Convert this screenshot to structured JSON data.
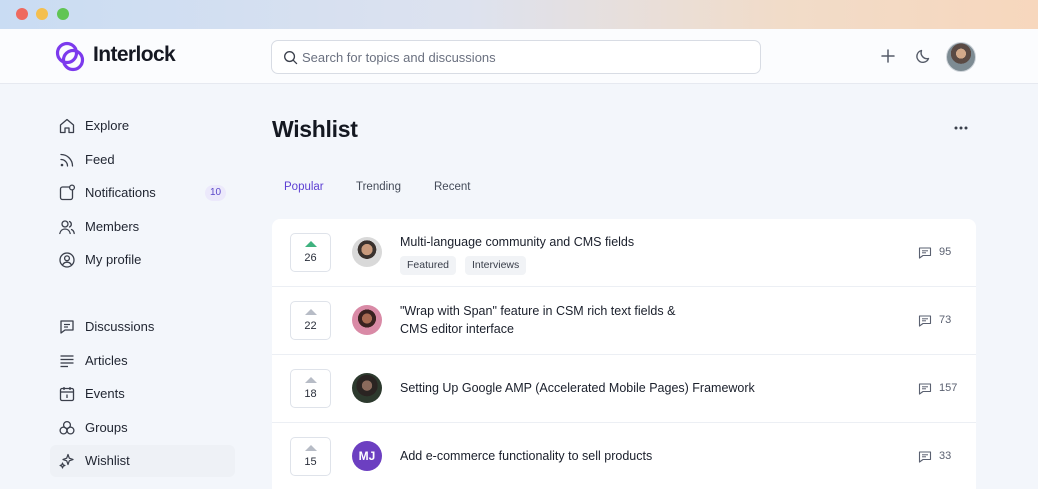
{
  "app": {
    "name": "Interlock"
  },
  "search": {
    "placeholder": "Search for topics and discussions"
  },
  "header": {
    "actions": [
      "plus-icon",
      "moon-icon",
      "avatar"
    ]
  },
  "sidebar": {
    "items": [
      {
        "label": "Explore",
        "icon": "home-icon"
      },
      {
        "label": "Feed",
        "icon": "rss-icon"
      },
      {
        "label": "Notifications",
        "icon": "notification-icon",
        "badge": "10"
      },
      {
        "label": "Members",
        "icon": "users-icon"
      },
      {
        "label": "My profile",
        "icon": "profile-icon"
      },
      {
        "label": "Discussions",
        "icon": "chat-icon"
      },
      {
        "label": "Articles",
        "icon": "lines-icon"
      },
      {
        "label": "Events",
        "icon": "calendar-icon"
      },
      {
        "label": "Groups",
        "icon": "groups-icon"
      },
      {
        "label": "Wishlist",
        "icon": "sparkle-icon",
        "active": true
      }
    ]
  },
  "main": {
    "title": "Wishlist",
    "tabs": [
      {
        "label": "Popular",
        "active": true
      },
      {
        "label": "Trending"
      },
      {
        "label": "Recent"
      }
    ],
    "rows": [
      {
        "votes": "26",
        "upvoted": true,
        "title": "Multi-language community and CMS fields",
        "tags": [
          "Featured",
          "Interviews"
        ],
        "comments": "95"
      },
      {
        "votes": "22",
        "title_line1": "\"Wrap with Span\" feature in CSM rich text fields &",
        "title_line2": "CMS editor interface",
        "comments": "73"
      },
      {
        "votes": "18",
        "title": "Setting Up Google AMP (Accelerated Mobile Pages) Framework",
        "comments": "157"
      },
      {
        "votes": "15",
        "avatar_initials": "MJ",
        "title": "Add e-commerce functionality to sell products",
        "comments": "33"
      }
    ]
  },
  "colors": {
    "accent": "#5d3fd3",
    "upvote": "#3fb27f",
    "badge_bg": "#ece9fb",
    "avatar_mj": "#6c3fc1"
  }
}
